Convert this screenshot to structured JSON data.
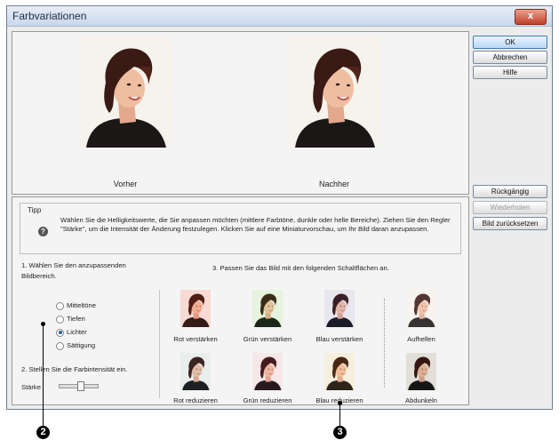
{
  "window": {
    "title": "Farbvariationen",
    "close_glyph": "x"
  },
  "preview": {
    "before_label": "Vorher",
    "after_label": "Nachher"
  },
  "tip": {
    "label": "Tipp",
    "icon": "help-icon",
    "text": "Wählen Sie die Helligkeitswerte, die Sie anpassen möchten (mittlere Farbtöne, dunkle oder helle Bereiche). Ziehen Sie den Regler \"Stärke\", um die Intensität der Änderung festzulegen. Klicken Sie auf eine Miniaturvorschau, um Ihr Bild daran anzupassen."
  },
  "step1": {
    "heading": "1. Wählen Sie den anzupassenden Bildbereich.",
    "options": [
      "Mitteltöne",
      "Tiefen",
      "Lichter",
      "Sättigung"
    ],
    "selected": "Lichter"
  },
  "step2": {
    "heading": "2. Stellen Sie die Farbintensität ein.",
    "slider_label": "Stärke"
  },
  "step3": {
    "heading": "3. Passen Sie das Bild mit den folgenden Schaltflächen an.",
    "row1": [
      "Rot verstärken",
      "Grün verstärken",
      "Blau verstärken",
      "Aufhellen"
    ],
    "row2": [
      "Rot reduzieren",
      "Grün reduzieren",
      "Blau reduzieren",
      "Abdunkeln"
    ]
  },
  "buttons": {
    "ok": "OK",
    "cancel": "Abbrechen",
    "help": "Hilfe",
    "undo": "Rückgängig",
    "redo": "Wiederholen",
    "reset": "Bild zurücksetzen"
  },
  "callouts": [
    "2",
    "3"
  ],
  "colors": {
    "accent_ok": "#b9d6f3",
    "window_bg": "#ececec"
  }
}
